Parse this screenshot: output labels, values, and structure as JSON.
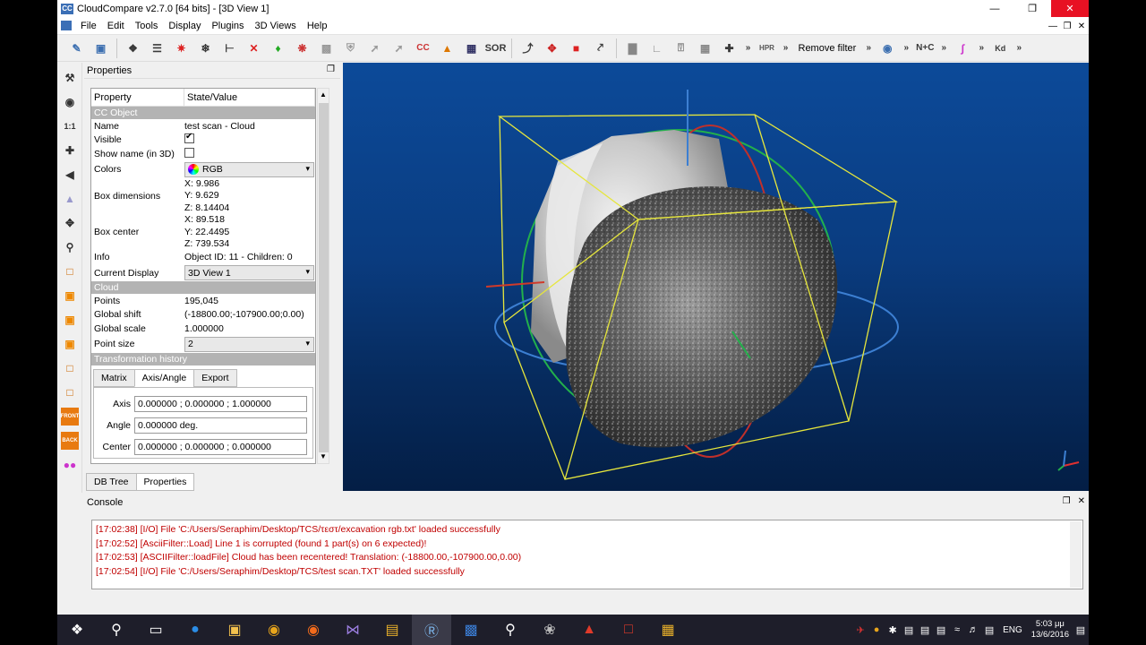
{
  "window": {
    "title": "CloudCompare v2.7.0 [64 bits] - [3D View 1]"
  },
  "menu": {
    "items": [
      "File",
      "Edit",
      "Tools",
      "Display",
      "Plugins",
      "3D Views",
      "Help"
    ]
  },
  "toolbar": {
    "remove_filter": "Remove filter",
    "sor": "SOR",
    "cc": "CC",
    "hpr": "HPR",
    "nc": "N+C",
    "kd": "Kd",
    "more": "»"
  },
  "lefttools": {
    "one_to_one": "1:1",
    "front": "FRONT",
    "back": "BACK"
  },
  "properties": {
    "title": "Properties",
    "header": {
      "property": "Property",
      "value": "State/Value"
    },
    "sections": {
      "cc_object": "CC Object",
      "cloud": "Cloud",
      "transformation": "Transformation history"
    },
    "rows": {
      "name": {
        "k": "Name",
        "v": "test scan - Cloud"
      },
      "visible": {
        "k": "Visible",
        "checked": true
      },
      "show_name": {
        "k": "Show name (in 3D)",
        "checked": false
      },
      "colors": {
        "k": "Colors",
        "v": "RGB"
      },
      "box_dims": {
        "k": "Box dimensions",
        "x": "X: 9.986",
        "y": "Y: 9.629",
        "z": "Z: 8.14404"
      },
      "box_center": {
        "k": "Box center",
        "x": "X: 89.518",
        "y": "Y: 22.4495",
        "z": "Z: 739.534"
      },
      "info": {
        "k": "Info",
        "v": "Object ID: 11 - Children: 0"
      },
      "current_display": {
        "k": "Current Display",
        "v": "3D View 1"
      },
      "points": {
        "k": "Points",
        "v": "195,045"
      },
      "global_shift": {
        "k": "Global shift",
        "v": "(-18800.00;-107900.00;0.00)"
      },
      "global_scale": {
        "k": "Global scale",
        "v": "1.000000"
      },
      "point_size": {
        "k": "Point size",
        "v": "2"
      }
    },
    "tabs": [
      "Matrix",
      "Axis/Angle",
      "Export"
    ],
    "axis": {
      "label": "Axis",
      "value": "0.000000 ; 0.000000 ; 1.000000"
    },
    "angle": {
      "label": "Angle",
      "value": "0.000000 deg."
    },
    "center": {
      "label": "Center",
      "value": "0.000000 ; 0.000000 ; 0.000000"
    }
  },
  "bottom_tabs": [
    "DB Tree",
    "Properties"
  ],
  "console": {
    "title": "Console",
    "lines": [
      "[17:02:38] [I/O] File 'C:/Users/Seraphim/Desktop/TCS/τεστ/excavation rgb.txt' loaded successfully",
      "[17:02:52] [AsciiFilter::Load] Line 1 is corrupted (found 1 part(s) on 6 expected)!",
      "[17:02:53] [ASCIIFilter::loadFile] Cloud has been recentered! Translation: (-18800.00,-107900.00,0.00)",
      "[17:02:54] [I/O] File 'C:/Users/Seraphim/Desktop/TCS/test scan.TXT' loaded successfully"
    ]
  },
  "taskbar": {
    "lang": "ENG",
    "time": "5:03 μμ",
    "date": "13/6/2016"
  },
  "colors": {
    "view_bg": "#0a3c80",
    "bbox": "#e6e63c",
    "log_text": "#c00000"
  }
}
